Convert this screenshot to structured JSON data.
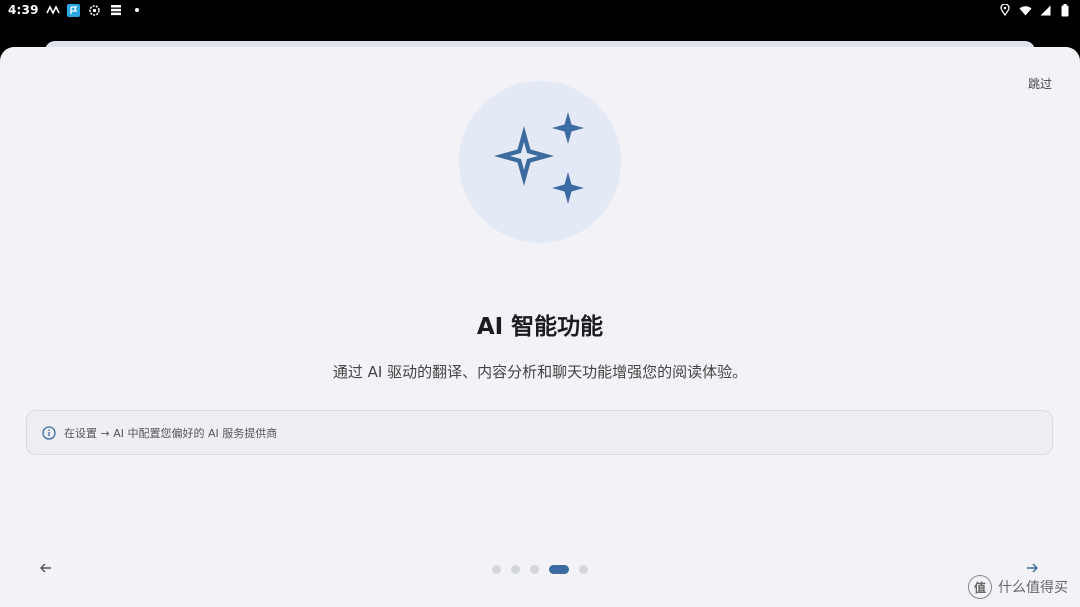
{
  "status_bar": {
    "time": "4:39",
    "left_icons": [
      "signal-wave-icon",
      "app-flag-icon",
      "settings-gear-icon",
      "storage-icon",
      "dot-icon"
    ],
    "right_icons": [
      "location-icon",
      "wifi-icon",
      "cell-signal-icon",
      "battery-icon"
    ]
  },
  "onboarding": {
    "skip_label": "跳过",
    "hero_icon": "sparkles-icon",
    "title": "AI 智能功能",
    "description": "通过 AI 驱动的翻译、内容分析和聊天功能增强您的阅读体验。",
    "info_text": "在设置 → AI 中配置您偏好的 AI 服务提供商",
    "pager": {
      "count": 5,
      "active_index": 3
    },
    "prev_icon": "arrow-left-icon",
    "next_icon": "arrow-right-icon"
  },
  "colors": {
    "accent": "#3b6ba0",
    "sheet_background": "#f3f2f7",
    "hero_circle": "#e4e9f6"
  },
  "watermark": {
    "badge": "值",
    "text": "什么值得买"
  }
}
